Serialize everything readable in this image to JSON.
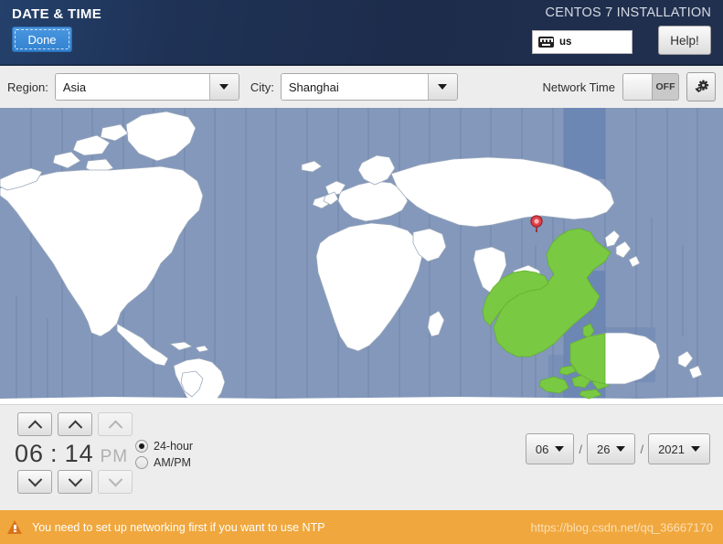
{
  "header": {
    "title": "DATE & TIME",
    "done_label": "Done",
    "install_title": "CENTOS 7 INSTALLATION",
    "keyboard_layout": "us",
    "keyboard_icon": "keyboard-icon",
    "help_label": "Help!"
  },
  "toolbar": {
    "region_label": "Region:",
    "region_value": "Asia",
    "city_label": "City:",
    "city_value": "Shanghai",
    "network_time_label": "Network Time",
    "network_time_state": "OFF",
    "config_icon": "gear-icon"
  },
  "map": {
    "highlight_color": "#7ac943",
    "ocean_color": "#8398ba",
    "land_color": "#ffffff",
    "selected_band_color": "#6d87b5",
    "marker_color": "#e0414a",
    "marker_label": "shanghai-location-marker"
  },
  "time": {
    "hours": "06",
    "separator": ":",
    "minutes": "14",
    "ampm": "PM",
    "format_options": [
      {
        "label": "24-hour",
        "selected": true
      },
      {
        "label": "AM/PM",
        "selected": false
      }
    ],
    "up_icon": "chevron-up-icon",
    "down_icon": "chevron-down-icon"
  },
  "date": {
    "month": "06",
    "day": "26",
    "year": "2021",
    "separator": "/"
  },
  "warning": {
    "icon": "warning-triangle-icon",
    "message": "You need to set up networking first if you want to use NTP",
    "watermark": "https://blog.csdn.net/qq_36667170",
    "bar_color": "#f0a73d"
  }
}
